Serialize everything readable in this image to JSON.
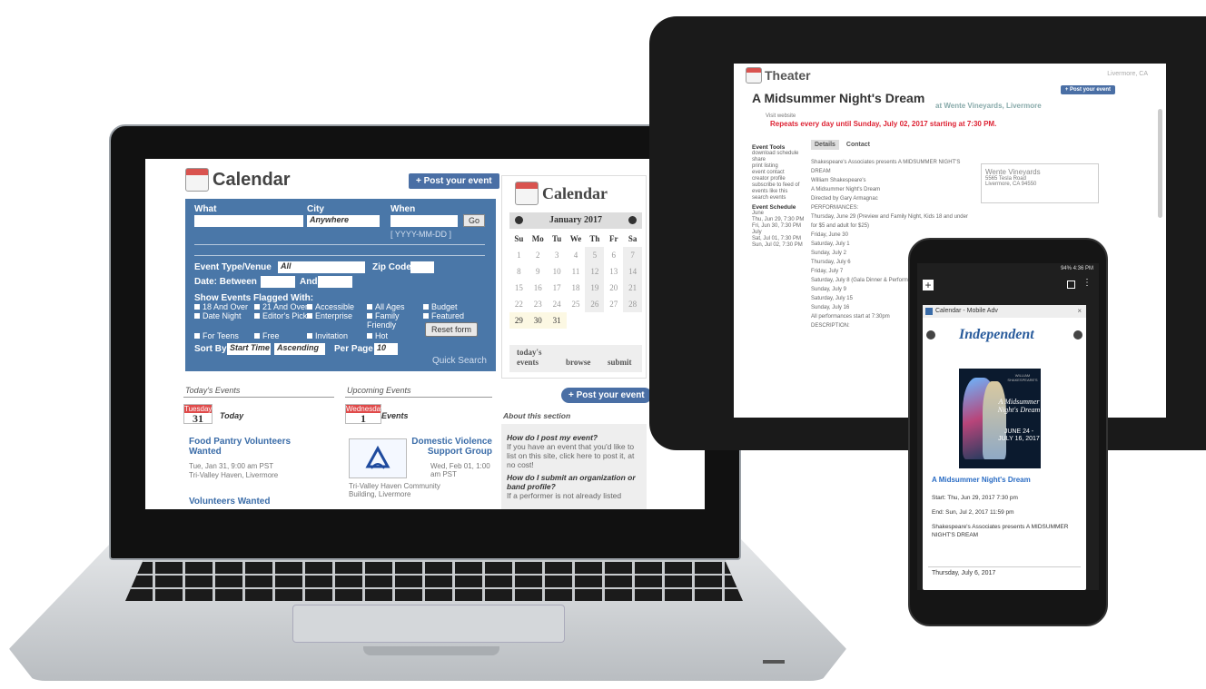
{
  "laptop": {
    "header_title": "Calendar",
    "post_event_label": "+ Post your event",
    "form": {
      "what_label": "What",
      "city_label": "City",
      "city_value": "Anywhere",
      "when_label": "When",
      "go_label": "Go",
      "date_hint": "[ YYYY-MM-DD ]",
      "type_label": "Event Type/Venue",
      "type_value": "All",
      "zip_label": "Zip Code",
      "between_label": "Date: Between",
      "and_label": "And",
      "flagged_label": "Show Events Flagged With:",
      "flags": [
        "18 And Over",
        "21 And Over",
        "Accessible",
        "All Ages",
        "Budget",
        "Date Night",
        "Editor's Pick",
        "Enterprise",
        "Family Friendly",
        "Featured",
        "For Teens",
        "Free",
        "Invitation",
        "Hot"
      ],
      "reset_label": "Reset form",
      "sort_label": "Sort By",
      "sort_value": "Start Time",
      "order_value": "Ascending",
      "per_page_label": "Per Page",
      "per_page_value": "10",
      "quick_search": "Quick Search"
    },
    "mini_calendar": {
      "title": "Calendar",
      "month": "January 2017",
      "day_names": [
        "Su",
        "Mo",
        "Tu",
        "We",
        "Th",
        "Fr",
        "Sa"
      ],
      "days": [
        "1",
        "2",
        "3",
        "4",
        "5",
        "6",
        "7",
        "8",
        "9",
        "10",
        "11",
        "12",
        "13",
        "14",
        "15",
        "16",
        "17",
        "18",
        "19",
        "20",
        "21",
        "22",
        "23",
        "24",
        "25",
        "26",
        "27",
        "28",
        "29",
        "30",
        "31"
      ],
      "foot_today": "today's events",
      "foot_browse": "browse",
      "foot_submit": "submit"
    },
    "todays_events": {
      "header": "Today's Events",
      "dow": "Tuesday",
      "day": "31",
      "label": "Today",
      "event1_title": "Food Pantry Volunteers Wanted",
      "event1_time": "Tue, Jan 31, 9:00 am PST",
      "event1_place": "Tri-Valley Haven, Livermore",
      "event2_title": "Volunteers Wanted"
    },
    "upcoming_events": {
      "header": "Upcoming Events",
      "dow": "Wednesday",
      "day": "1",
      "label": "Events",
      "event1_title": "Domestic Violence Support Group",
      "event1_time": "Wed, Feb 01, 1:00 am PST",
      "event1_place": "Tri-Valley Haven Community Building, Livermore"
    },
    "about": {
      "header": "About this section",
      "q1": "How do I post my event?",
      "a1": "If you have an event that you'd like to list on this site, click here to post it, at no cost!",
      "q2": "How do I submit an organization or band profile?",
      "a2": "If a performer is not already listed"
    }
  },
  "tablet": {
    "section_title": "Theater",
    "location": "Livermore, CA",
    "post_event_label": "+ Post your event",
    "event_title": "A Midsummer Night's Dream",
    "venue_line": "at Wente Vineyards, Livermore",
    "visit_website": "Visit website",
    "repeats": "Repeats every day until Sunday, July 02, 2017 starting at 7:30 PM.",
    "tools_header": "Event Tools",
    "tools": [
      "download schedule",
      "share",
      "print listing",
      "event contact",
      "creator profile",
      "subscribe to feed of events like this",
      "search events"
    ],
    "schedule_header": "Event Schedule",
    "schedule": [
      "June",
      "Thu, Jun 29, 7:30 PM",
      "Fri, Jun 30, 7:30 PM",
      "July",
      "Sat, Jul 01, 7:30 PM",
      "Sun, Jul 02, 7:30 PM"
    ],
    "tab_details": "Details",
    "tab_contact": "Contact",
    "body_lines": [
      "Shakespeare's Associates presents A MIDSUMMER NIGHT'S DREAM",
      "William Shakespeare's",
      "A Midsummer Night's Dream",
      "Directed by Gary Armagnac",
      "PERFORMANCES:",
      "Thursday, June 29 (Preview and Family Night, Kids 18 and under for $5 and adult for $25)",
      "Friday, June 30",
      "Saturday, July 1",
      "Sunday, July 2",
      "Thursday, July 6",
      "Friday, July 7",
      "Saturday, July 8 (Gala Dinner & Performance, 6:00 pm)",
      "Sunday, July 9",
      "Saturday, July 15",
      "Sunday, July 16",
      "All performances start at 7:30pm",
      "DESCRIPTION:"
    ],
    "venue_box_name": "Wente Vineyards",
    "venue_box_addr1": "5565 Tesla Road",
    "venue_box_addr2": "Livermore, CA 94550"
  },
  "phone": {
    "status_bar": "94% 4:36 PM",
    "card_title": "Calendar - Mobile Adv",
    "logo": "Independent",
    "poster_small": "WILLIAM SHAKESPEARE'S",
    "poster_title": "A Midsummer Night's Dream",
    "poster_dates": "JUNE 24 - JULY 16, 2017",
    "event_title": "A Midsummer Night's Dream",
    "start": "Start: Thu, Jun 29, 2017 7:30 pm",
    "end": "End: Sun, Jul 2, 2017 11:59 pm",
    "desc": "Shakespeare's Associates presents A MIDSUMMER NIGHT'S DREAM",
    "footer_date": "Thursday, July 6, 2017"
  }
}
